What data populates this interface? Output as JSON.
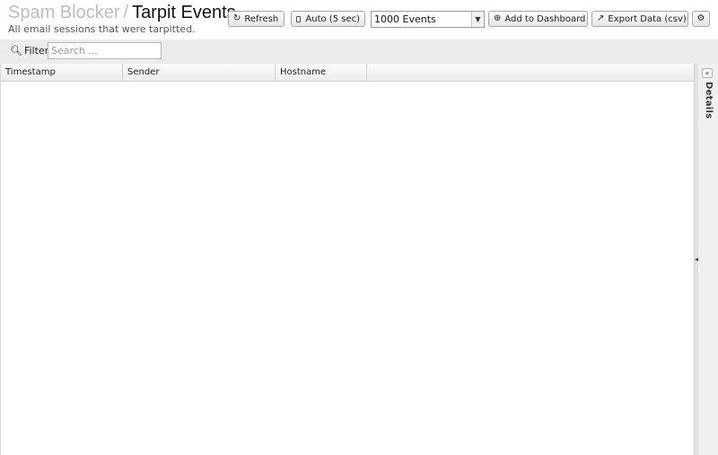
{
  "header": {
    "breadcrumb_parent": "Spam Blocker",
    "breadcrumb_separator": "/",
    "title": "Tarpit Events",
    "subtitle": "All email sessions that were tarpitted."
  },
  "toolbar": {
    "refresh_label": "Refresh",
    "auto_label": "Auto (5 sec)",
    "auto_checked": false,
    "events_select_value": "1000 Events",
    "add_dashboard_label": "Add to Dashboard",
    "export_label": "Export Data (csv)"
  },
  "filter": {
    "label": "Filter",
    "placeholder": "Search ..."
  },
  "grid": {
    "columns": [
      "Timestamp",
      "Sender",
      "Hostname"
    ],
    "rows": []
  },
  "details_panel": {
    "label": "Details"
  }
}
